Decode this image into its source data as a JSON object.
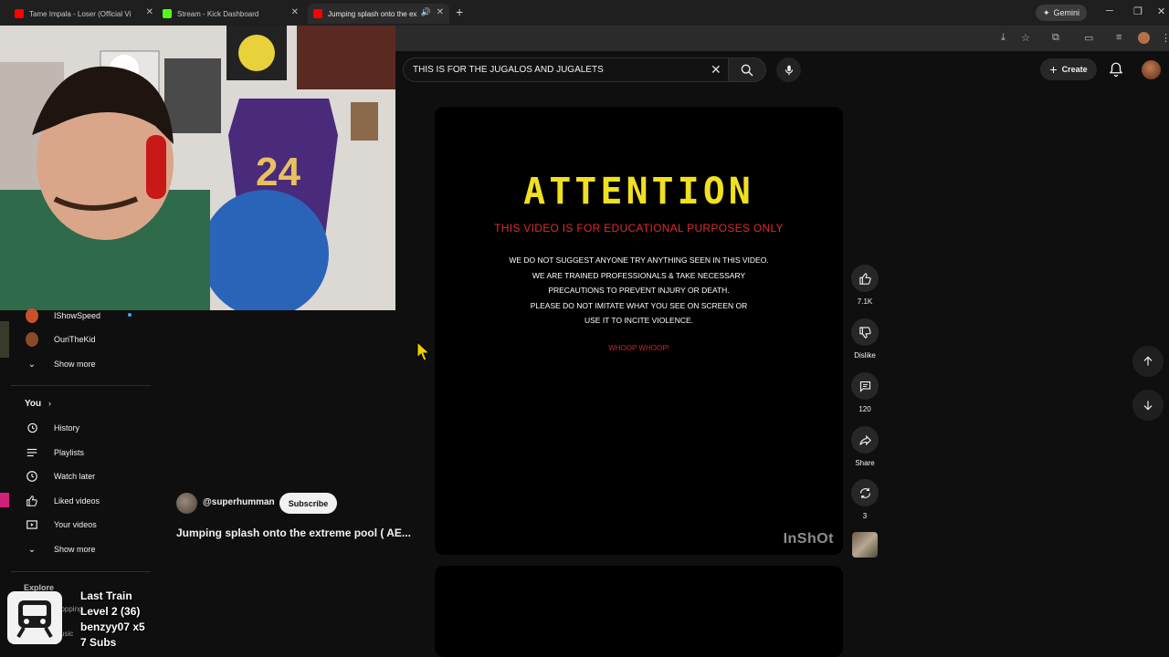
{
  "browser": {
    "tabs": [
      {
        "title": "Tame Impala - Loser (Official Vi",
        "favicon_color": "#ff0000"
      },
      {
        "title": "Stream - Kick Dashboard",
        "favicon_color": "#53fc18"
      },
      {
        "title": "Jumping splash onto the ex",
        "favicon_color": "#ff0000"
      }
    ],
    "new_tab_label": "+",
    "gemini_label": "Gemini"
  },
  "header": {
    "search_query": "THIS IS FOR THE JUGALOS AND JUGALETS",
    "create_label": "Create"
  },
  "sidebar": {
    "subscriptions": [
      {
        "label": "IShowSpeed",
        "avatar_color": "#c8502a"
      },
      {
        "label": "OuriTheKid",
        "avatar_color": "#8a4a2a"
      }
    ],
    "show_more_1": "Show more",
    "you_label": "You",
    "you_items": [
      {
        "label": "History",
        "icon": "history-icon"
      },
      {
        "label": "Playlists",
        "icon": "playlists-icon"
      },
      {
        "label": "Watch later",
        "icon": "watch-later-icon"
      },
      {
        "label": "Liked videos",
        "icon": "liked-videos-icon"
      },
      {
        "label": "Your videos",
        "icon": "your-videos-icon"
      }
    ],
    "show_more_2": "Show more",
    "explore_label": "Explore",
    "shopping_label": "hopping",
    "music_label": "usic"
  },
  "video": {
    "attention_title": "ATTENTION",
    "attention_subtitle": "THIS VIDEO IS FOR EDUCATIONAL PURPOSES ONLY",
    "attention_lines": [
      "WE DO NOT SUGGEST ANYONE TRY ANYTHING SEEN IN THIS VIDEO.",
      "WE ARE TRAINED PROFESSIONALS & TAKE NECESSARY",
      "PRECAUTIONS TO PREVENT INJURY OR DEATH.",
      "PLEASE DO NOT IMITATE WHAT YOU SEE ON SCREEN OR",
      "USE IT TO INCITE VIOLENCE."
    ],
    "whoop": "WHOOP WHOOP!",
    "watermark": "InShOt",
    "channel": "@superhumman",
    "subscribe_label": "Subscribe",
    "title": "Jumping splash onto the extreme pool ( AE..."
  },
  "actions": {
    "likes": "7.1K",
    "dislike_label": "Dislike",
    "comments": "120",
    "share_label": "Share",
    "remix_count": "3"
  },
  "alert": {
    "line1": "Last Train",
    "line2": "Level 2  (36)",
    "line3": "benzyy07 x5",
    "line4": "7 Subs"
  },
  "colors": {
    "background": "#0f0f0f",
    "attention_yellow": "#f1e021",
    "attention_red": "#e02a2a"
  }
}
